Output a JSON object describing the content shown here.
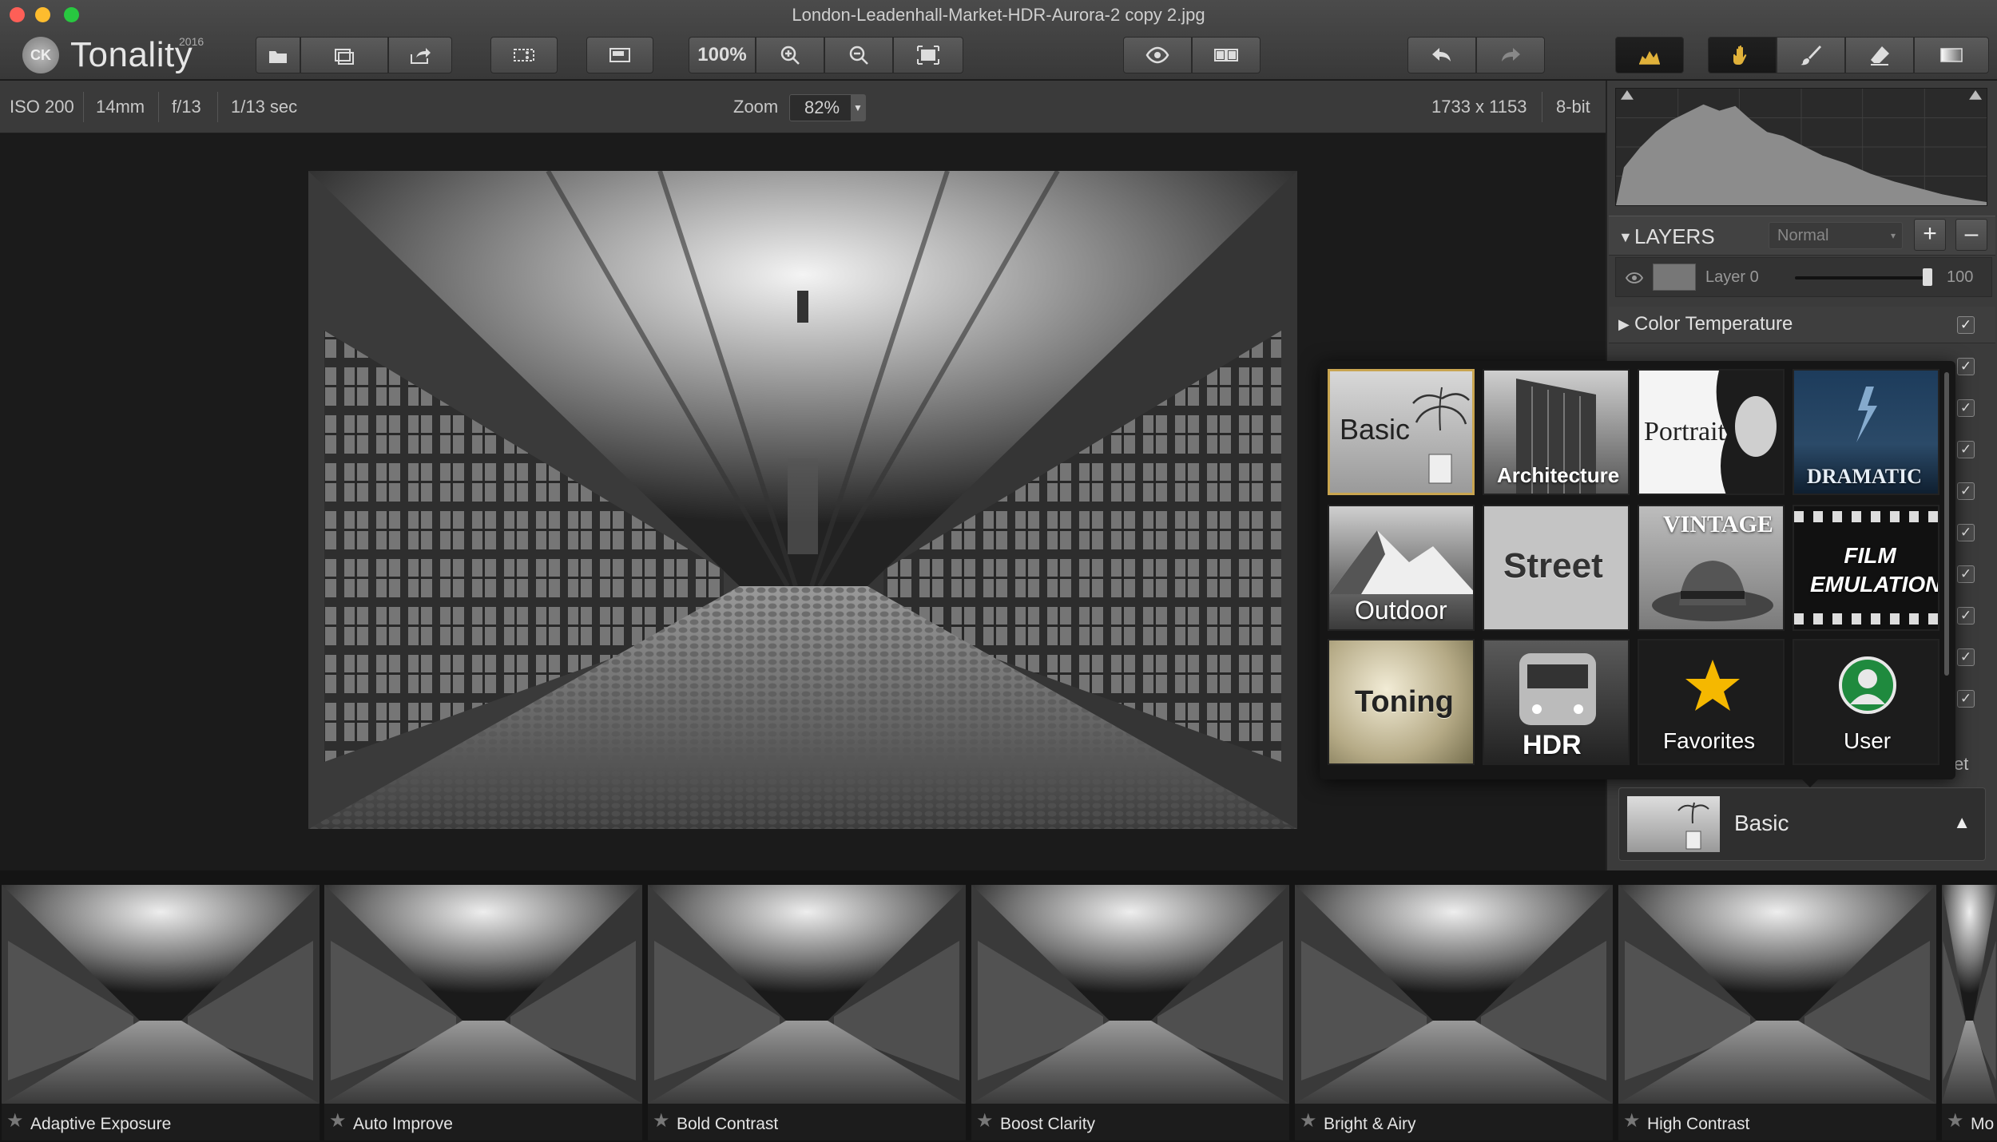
{
  "window": {
    "title": "London-Leadenhall-Market-HDR-Aurora-2 copy 2.jpg",
    "traffic": {
      "close": "#fe5f57",
      "min": "#febc2e",
      "max": "#28c840"
    }
  },
  "app": {
    "logo_mark": "CK",
    "name": "Tonality",
    "year": "2016"
  },
  "toolbar": {
    "zoom_100": "100%",
    "icons": [
      "open-icon",
      "batch-icon",
      "export-icon",
      "crop-icon",
      "single-view-icon",
      "zoom-100",
      "zoom-in-icon",
      "zoom-out-icon",
      "fit-icon",
      "preview-eye-icon",
      "split-view-icon",
      "undo-icon",
      "redo-icon",
      "histogram-icon",
      "hand-tool-icon",
      "brush-icon",
      "eraser-icon",
      "gradient-icon"
    ]
  },
  "infobar": {
    "iso": "ISO 200",
    "focal": "14mm",
    "aperture": "f/13",
    "shutter": "1/13 sec",
    "zoom_label": "Zoom",
    "zoom_value": "82%",
    "dimensions": "1733 x 1153",
    "bit_depth": "8-bit"
  },
  "layers": {
    "title": "LAYERS",
    "blend_mode": "Normal",
    "add": "+",
    "remove": "–",
    "layer_name": "Layer 0",
    "opacity": "100"
  },
  "sections": {
    "color_temperature": "Color Temperature"
  },
  "popup": {
    "categories": [
      {
        "label": "Basic"
      },
      {
        "label": "Architecture"
      },
      {
        "label": "Portrait"
      },
      {
        "label": "DRAMATIC"
      },
      {
        "label": "Outdoor"
      },
      {
        "label": "Street"
      },
      {
        "label": "VINTAGE"
      },
      {
        "label": "FILM EMULATION"
      },
      {
        "label": "Toning"
      },
      {
        "label": "HDR"
      },
      {
        "label": "Favorites"
      },
      {
        "label": "User"
      }
    ],
    "partial_text": "et"
  },
  "preset_selector": {
    "label": "Basic",
    "arrow": "▲"
  },
  "filmstrip": {
    "items": [
      {
        "label": "Adaptive Exposure"
      },
      {
        "label": "Auto Improve"
      },
      {
        "label": "Bold Contrast"
      },
      {
        "label": "Boost Clarity"
      },
      {
        "label": "Bright & Airy"
      },
      {
        "label": "High Contrast"
      },
      {
        "label": "Mo"
      }
    ],
    "star": "★"
  }
}
